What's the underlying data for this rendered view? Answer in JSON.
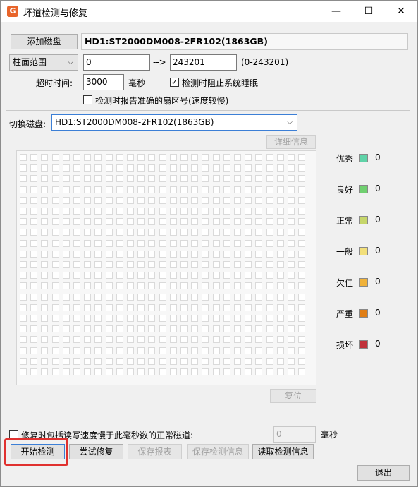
{
  "window": {
    "title": "坏道检测与修复",
    "app_icon_letter": "G",
    "minimize_glyph": "—",
    "maximize_glyph": "☐",
    "close_glyph": "✕"
  },
  "top": {
    "add_disk_label": "添加磁盘",
    "disk_title": "HD1:ST2000DM008-2FR102(1863GB)",
    "range_mode": "柱面范围",
    "range_start": "0",
    "range_arrow": "-->",
    "range_end": "243201",
    "range_hint": "(0-243201)",
    "timeout_label": "超时时间:",
    "timeout_value": "3000",
    "timeout_unit": "毫秒",
    "prevent_sleep_label": "检测时阻止系统睡眠",
    "prevent_sleep_checked": true,
    "report_sector_label": "检测时报告准确的扇区号(速度较慢)",
    "report_sector_checked": false
  },
  "switch": {
    "label": "切换磁盘:",
    "selected_disk": "HD1:ST2000DM008-2FR102(1863GB)"
  },
  "detail_button_label": "详细信息",
  "reset_button_label": "复位",
  "legend": [
    {
      "label": "优秀",
      "color": "#5fd3a8",
      "count": "0"
    },
    {
      "label": "良好",
      "color": "#70d070",
      "count": "0"
    },
    {
      "label": "正常",
      "color": "#c6d66a",
      "count": "0"
    },
    {
      "label": "一般",
      "color": "#f2df7a",
      "count": "0"
    },
    {
      "label": "欠佳",
      "color": "#f0b23a",
      "count": "0"
    },
    {
      "label": "严重",
      "color": "#e07e15",
      "count": "0"
    },
    {
      "label": "损坏",
      "color": "#c0313a",
      "count": "0"
    }
  ],
  "bottom": {
    "slow_track_label": "修复时包括读写速度慢于此毫秒数的正常磁道:",
    "slow_track_checked": false,
    "slow_track_value": "0",
    "slow_track_unit": "毫秒",
    "start_label": "开始检测",
    "repair_label": "尝试修复",
    "save_report_label": "保存报表",
    "save_info_label": "保存检测信息",
    "load_info_label": "读取检测信息",
    "exit_label": "退出"
  }
}
